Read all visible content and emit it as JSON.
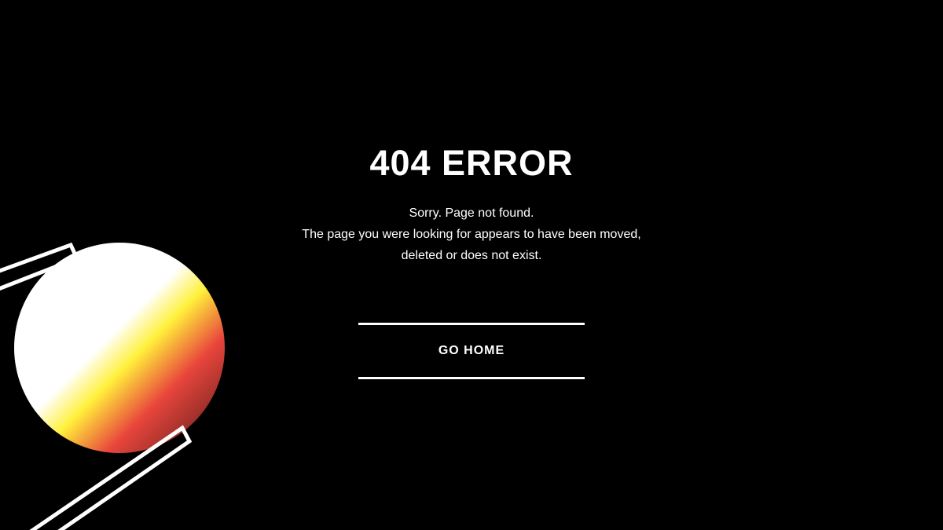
{
  "error": {
    "title": "404 ERROR",
    "message_lines": [
      "Sorry. Page not found.",
      "The page you were looking for appears to have been moved,",
      "deleted or does not exist."
    ]
  },
  "actions": {
    "go_home_label": "GO HOME"
  },
  "colors": {
    "background": "#000000",
    "text": "#ffffff",
    "sphere_gradient": [
      "#ffffff",
      "#ffef3d",
      "#e8453c",
      "#5a1f1a"
    ]
  }
}
